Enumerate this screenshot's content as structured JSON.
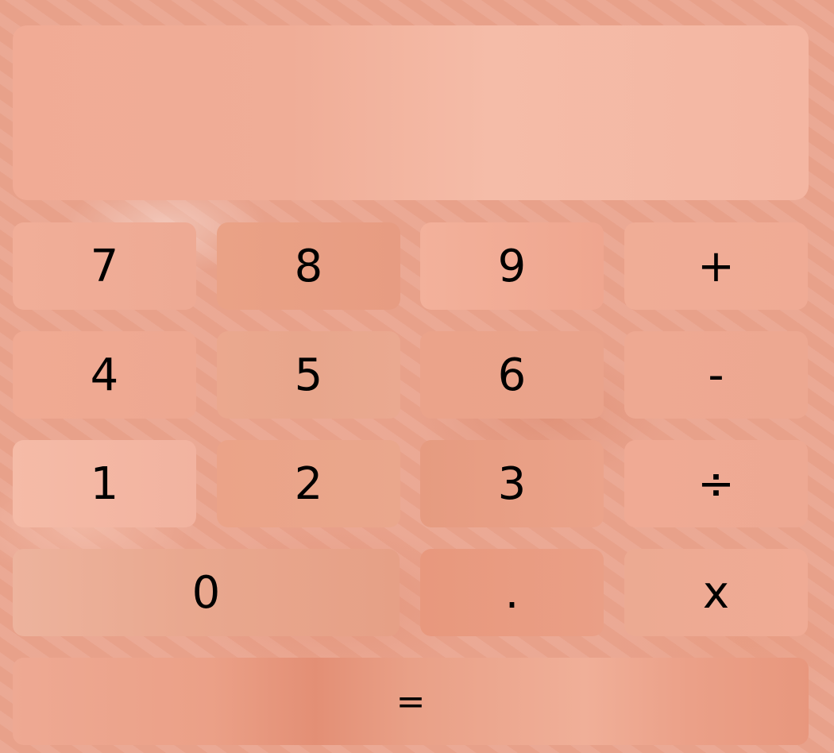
{
  "display": {
    "value": ""
  },
  "keys": {
    "seven": "7",
    "eight": "8",
    "nine": "9",
    "plus": "+",
    "four": "4",
    "five": "5",
    "six": "6",
    "minus": "-",
    "one": "1",
    "two": "2",
    "three": "3",
    "divide": "÷",
    "zero": "0",
    "decimal": ".",
    "multiply": "x",
    "equals": "="
  }
}
